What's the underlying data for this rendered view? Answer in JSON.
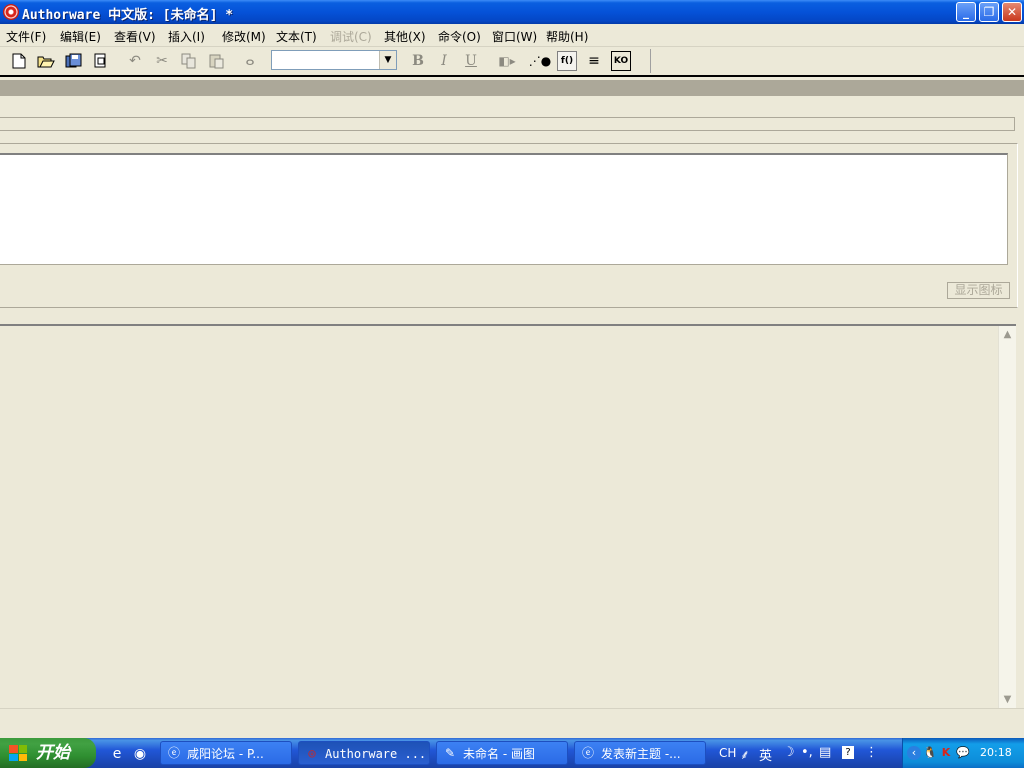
{
  "window": {
    "title": "Authorware 中文版: [未命名] *",
    "controls": {
      "minimize": "_",
      "restore": "❐",
      "close": "✕"
    }
  },
  "menu": [
    "文件(F)",
    "编辑(E)",
    "查看(V)",
    "插入(I)",
    "修改(M)",
    "文本(T)",
    "调试(C)",
    "其他(X)",
    "命令(O)",
    "窗口(W)",
    "帮助(H)"
  ],
  "toolbar": {
    "icons": [
      "new-file-icon",
      "open-file-icon",
      "save-all-icon",
      "import-icon",
      "undo-icon",
      "cut-icon",
      "copy-icon",
      "paste-icon",
      "find-icon",
      "bold-icon",
      "italic-icon",
      "underline-icon",
      "run-icon",
      "control-panel-icon",
      "functions-icon",
      "variables-icon",
      "knowledge-objects-icon"
    ],
    "font_combo_value": "",
    "bold": "B",
    "italic": "I",
    "underline": "U",
    "functions_label": "f()",
    "variables_label": "≡",
    "knowledge_objects_label": "KO"
  },
  "properties_panel": {
    "show_icon_button": "显示图标"
  },
  "taskbar": {
    "start_label": "开始",
    "tasks": [
      {
        "label": "咸阳论坛 - P...",
        "icon": "ie-icon"
      },
      {
        "label": "Authorware ...",
        "icon": "authorware-icon",
        "active": true
      },
      {
        "label": "未命名 - 画图",
        "icon": "paint-icon"
      },
      {
        "label": "发表新主题 -...",
        "icon": "ie-icon"
      }
    ],
    "ime": {
      "lang": "CH",
      "mode": "英"
    },
    "clock": "20:18"
  },
  "colors": {
    "titlebar": "#0552d8",
    "taskbar": "#2157d7",
    "start": "#3c9a3c",
    "face": "#ece9d8"
  }
}
